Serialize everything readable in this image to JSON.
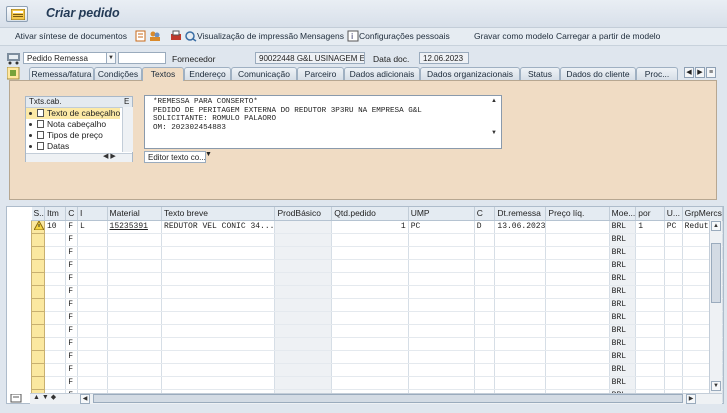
{
  "window": {
    "title": "Criar pedido"
  },
  "toolbar": {
    "items": [
      "Ativar síntese de documentos",
      "Visualização de impressão",
      "Mensagens",
      "Configurações pessoais",
      "Gravar como modelo",
      "Carregar a partir de modelo"
    ]
  },
  "header": {
    "doc_type": "Pedido Remessa",
    "vendor_label": "Fornecedor",
    "vendor_value": "90022448 G&L USINAGEM E SER...",
    "doc_date_label": "Data doc.",
    "doc_date_value": "12.06.2023"
  },
  "tabs": [
    "Remessa/fatura",
    "Condições",
    "Textos",
    "Endereço",
    "Comunicação",
    "Parceiro",
    "Dados adicionais",
    "Dados organizacionais",
    "Status",
    "Dados do cliente",
    "Proc..."
  ],
  "active_tab": "Textos",
  "texts": {
    "tree_header": "Txts.cab.",
    "tree_col2": "E",
    "types": [
      "Texto de cabeçalho",
      "Nota cabeçalho",
      "Tipos de preço",
      "Datas"
    ],
    "selected_type": "Texto de cabeçalho",
    "content_lines": [
      "*REMESSA PARA CONSERTO*",
      "PEDIDO DE PERITAGEM EXTERNA DO REDUTOR 3P3RU NA EMPRESA G&L",
      "SOLICITANTE: ROMULO PALAORO",
      "OM: 202302454883"
    ],
    "editor_select": "Editor texto co..."
  },
  "grid": {
    "columns": [
      "S..",
      "Itm",
      "C",
      "I",
      "Material",
      "Texto breve",
      "ProdBásico",
      "Qtd.pedido",
      "UMP",
      "C",
      "Dt.remessa",
      "Preço líq.",
      "Moe...",
      "por",
      "U...",
      "GrpMercs"
    ],
    "rows": [
      {
        "status": "warn",
        "itm": "10",
        "c": "F",
        "i": "L",
        "material": "15235391",
        "texto": "REDUTOR VEL CONIC 34...",
        "prod": "",
        "qtd": "1",
        "ump": "PC",
        "c2": "D",
        "dt": "13.06.2023",
        "preco": "",
        "moeda": "BRL",
        "por": "1",
        "u": "PC",
        "grp": "Redutor"
      }
    ],
    "empty_row_c": "F",
    "empty_row_moeda": "BRL",
    "empty_rows": 13
  }
}
